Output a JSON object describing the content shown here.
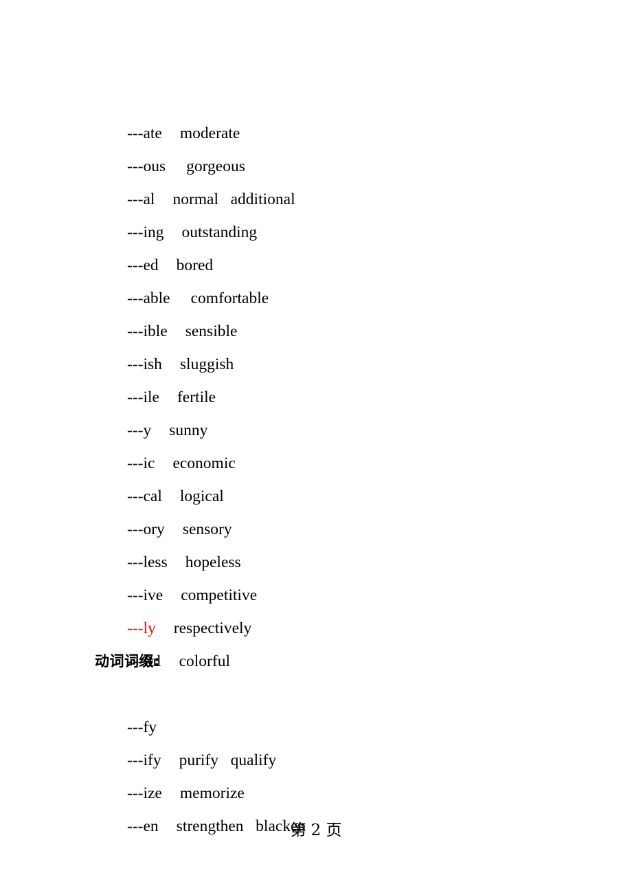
{
  "page": {
    "background_color": "#ffffff",
    "text_color": "#000000",
    "accent_color": "#ff0000",
    "footer_label": "第 2 页"
  },
  "adjective_section": {
    "lines": [
      {
        "suffix": "---ate",
        "examples": "moderate",
        "highlight": false
      },
      {
        "suffix": "---ous",
        "examples": "gorgeous",
        "highlight": false
      },
      {
        "suffix": "---al",
        "examples": "normal   additional",
        "highlight": false
      },
      {
        "suffix": "---ing",
        "examples": "outstanding",
        "highlight": false
      },
      {
        "suffix": "---ed",
        "examples": "bored",
        "highlight": false
      },
      {
        "suffix": "---able",
        "examples": "comfortable",
        "highlight": false
      },
      {
        "suffix": "---ible",
        "examples": "sensible",
        "highlight": false
      },
      {
        "suffix": "---ish",
        "examples": "sluggish",
        "highlight": false
      },
      {
        "suffix": "---ile",
        "examples": "fertile",
        "highlight": false
      },
      {
        "suffix": "---y",
        "examples": "sunny",
        "highlight": false
      },
      {
        "suffix": "---ic",
        "examples": "economic",
        "highlight": false
      },
      {
        "suffix": "---cal",
        "examples": "logical",
        "highlight": false
      },
      {
        "suffix": "---ory",
        "examples": "sensory",
        "highlight": false
      },
      {
        "suffix": "---less",
        "examples": "hopeless",
        "highlight": false
      },
      {
        "suffix": "---ive",
        "examples": "competitive",
        "highlight": false
      },
      {
        "suffix": "---ly",
        "examples": "respectively",
        "highlight": true
      },
      {
        "suffix": "---ful",
        "examples": "colorful",
        "highlight": false
      }
    ]
  },
  "verb_section": {
    "heading": "动词词缀:",
    "lines": [
      {
        "suffix": "---fy",
        "examples": "",
        "highlight": false
      },
      {
        "suffix": "---ify",
        "examples": "purify   qualify",
        "highlight": false
      },
      {
        "suffix": "---ize",
        "examples": "memorize",
        "highlight": false
      },
      {
        "suffix": "---en",
        "examples": "strengthen   blacken",
        "highlight": false
      }
    ]
  }
}
